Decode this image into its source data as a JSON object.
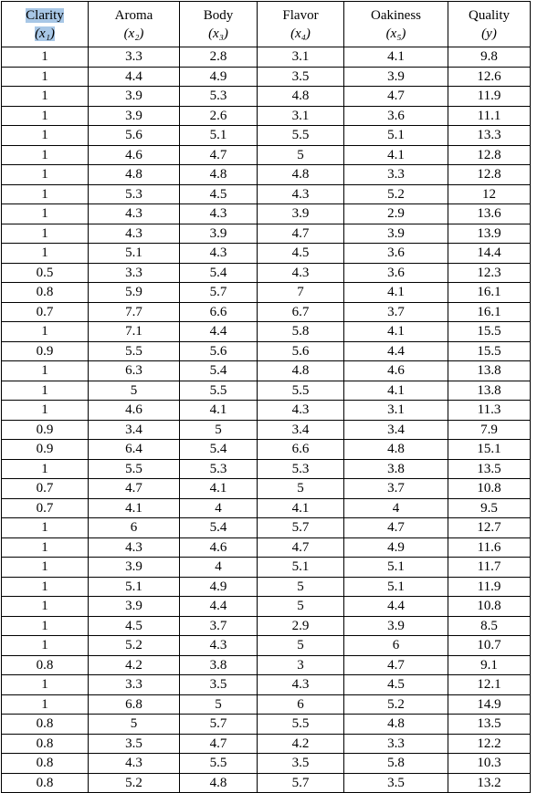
{
  "table": {
    "highlight_color": "#a8c7e6",
    "columns": [
      {
        "name": "Clarity",
        "symbol": "(x₁)",
        "highlighted": true
      },
      {
        "name": "Aroma",
        "symbol": "(x₂)",
        "highlighted": false
      },
      {
        "name": "Body",
        "symbol": "(x₃)",
        "highlighted": false
      },
      {
        "name": "Flavor",
        "symbol": "(x₄)",
        "highlighted": false
      },
      {
        "name": "Oakiness",
        "symbol": "(x₅)",
        "highlighted": false
      },
      {
        "name": "Quality",
        "symbol": "(y)",
        "highlighted": false
      }
    ],
    "rows": [
      [
        "1",
        "3.3",
        "2.8",
        "3.1",
        "4.1",
        "9.8"
      ],
      [
        "1",
        "4.4",
        "4.9",
        "3.5",
        "3.9",
        "12.6"
      ],
      [
        "1",
        "3.9",
        "5.3",
        "4.8",
        "4.7",
        "11.9"
      ],
      [
        "1",
        "3.9",
        "2.6",
        "3.1",
        "3.6",
        "11.1"
      ],
      [
        "1",
        "5.6",
        "5.1",
        "5.5",
        "5.1",
        "13.3"
      ],
      [
        "1",
        "4.6",
        "4.7",
        "5",
        "4.1",
        "12.8"
      ],
      [
        "1",
        "4.8",
        "4.8",
        "4.8",
        "3.3",
        "12.8"
      ],
      [
        "1",
        "5.3",
        "4.5",
        "4.3",
        "5.2",
        "12"
      ],
      [
        "1",
        "4.3",
        "4.3",
        "3.9",
        "2.9",
        "13.6"
      ],
      [
        "1",
        "4.3",
        "3.9",
        "4.7",
        "3.9",
        "13.9"
      ],
      [
        "1",
        "5.1",
        "4.3",
        "4.5",
        "3.6",
        "14.4"
      ],
      [
        "0.5",
        "3.3",
        "5.4",
        "4.3",
        "3.6",
        "12.3"
      ],
      [
        "0.8",
        "5.9",
        "5.7",
        "7",
        "4.1",
        "16.1"
      ],
      [
        "0.7",
        "7.7",
        "6.6",
        "6.7",
        "3.7",
        "16.1"
      ],
      [
        "1",
        "7.1",
        "4.4",
        "5.8",
        "4.1",
        "15.5"
      ],
      [
        "0.9",
        "5.5",
        "5.6",
        "5.6",
        "4.4",
        "15.5"
      ],
      [
        "1",
        "6.3",
        "5.4",
        "4.8",
        "4.6",
        "13.8"
      ],
      [
        "1",
        "5",
        "5.5",
        "5.5",
        "4.1",
        "13.8"
      ],
      [
        "1",
        "4.6",
        "4.1",
        "4.3",
        "3.1",
        "11.3"
      ],
      [
        "0.9",
        "3.4",
        "5",
        "3.4",
        "3.4",
        "7.9"
      ],
      [
        "0.9",
        "6.4",
        "5.4",
        "6.6",
        "4.8",
        "15.1"
      ],
      [
        "1",
        "5.5",
        "5.3",
        "5.3",
        "3.8",
        "13.5"
      ],
      [
        "0.7",
        "4.7",
        "4.1",
        "5",
        "3.7",
        "10.8"
      ],
      [
        "0.7",
        "4.1",
        "4",
        "4.1",
        "4",
        "9.5"
      ],
      [
        "1",
        "6",
        "5.4",
        "5.7",
        "4.7",
        "12.7"
      ],
      [
        "1",
        "4.3",
        "4.6",
        "4.7",
        "4.9",
        "11.6"
      ],
      [
        "1",
        "3.9",
        "4",
        "5.1",
        "5.1",
        "11.7"
      ],
      [
        "1",
        "5.1",
        "4.9",
        "5",
        "5.1",
        "11.9"
      ],
      [
        "1",
        "3.9",
        "4.4",
        "5",
        "4.4",
        "10.8"
      ],
      [
        "1",
        "4.5",
        "3.7",
        "2.9",
        "3.9",
        "8.5"
      ],
      [
        "1",
        "5.2",
        "4.3",
        "5",
        "6",
        "10.7"
      ],
      [
        "0.8",
        "4.2",
        "3.8",
        "3",
        "4.7",
        "9.1"
      ],
      [
        "1",
        "3.3",
        "3.5",
        "4.3",
        "4.5",
        "12.1"
      ],
      [
        "1",
        "6.8",
        "5",
        "6",
        "5.2",
        "14.9"
      ],
      [
        "0.8",
        "5",
        "5.7",
        "5.5",
        "4.8",
        "13.5"
      ],
      [
        "0.8",
        "3.5",
        "4.7",
        "4.2",
        "3.3",
        "12.2"
      ],
      [
        "0.8",
        "4.3",
        "5.5",
        "3.5",
        "5.8",
        "10.3"
      ],
      [
        "0.8",
        "5.2",
        "4.8",
        "5.7",
        "3.5",
        "13.2"
      ]
    ]
  }
}
